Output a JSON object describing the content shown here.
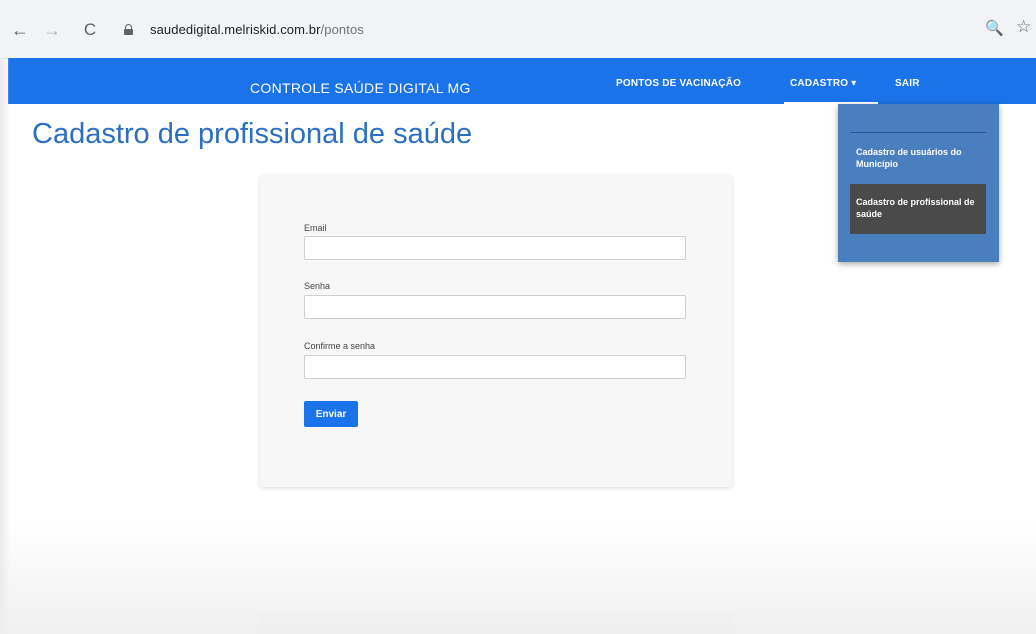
{
  "browser": {
    "back_icon": "←",
    "forward_icon": "→",
    "reload_icon": "C",
    "url_domain": "saudedigital.melriskid.com.br",
    "url_path": "/pontos",
    "zoom_icon": "🔍",
    "star_icon": "☆"
  },
  "navbar": {
    "brand": "CONTROLE SAÚDE DIGITAL MG",
    "links": {
      "pontos": "PONTOS DE VACINAÇÃO",
      "cadastro": "CADASTRO ▾",
      "sair": "SAIR"
    },
    "color": "#1a73e8"
  },
  "dropdown": {
    "items": [
      "Cadastro de usuários do Município",
      "Cadastro de profissional de saúde"
    ],
    "background": "#4a7fbf",
    "selected_background": "#4a4a4a"
  },
  "page": {
    "title": "Cadastro de profissional de saúde",
    "title_color": "#2a6fc2"
  },
  "form": {
    "fields": {
      "email_label": "Email",
      "email_value": "",
      "senha_label": "Senha",
      "senha_value": "",
      "confirm_label": "Confirme a senha",
      "confirm_value": ""
    },
    "submit_label": "Enviar"
  }
}
